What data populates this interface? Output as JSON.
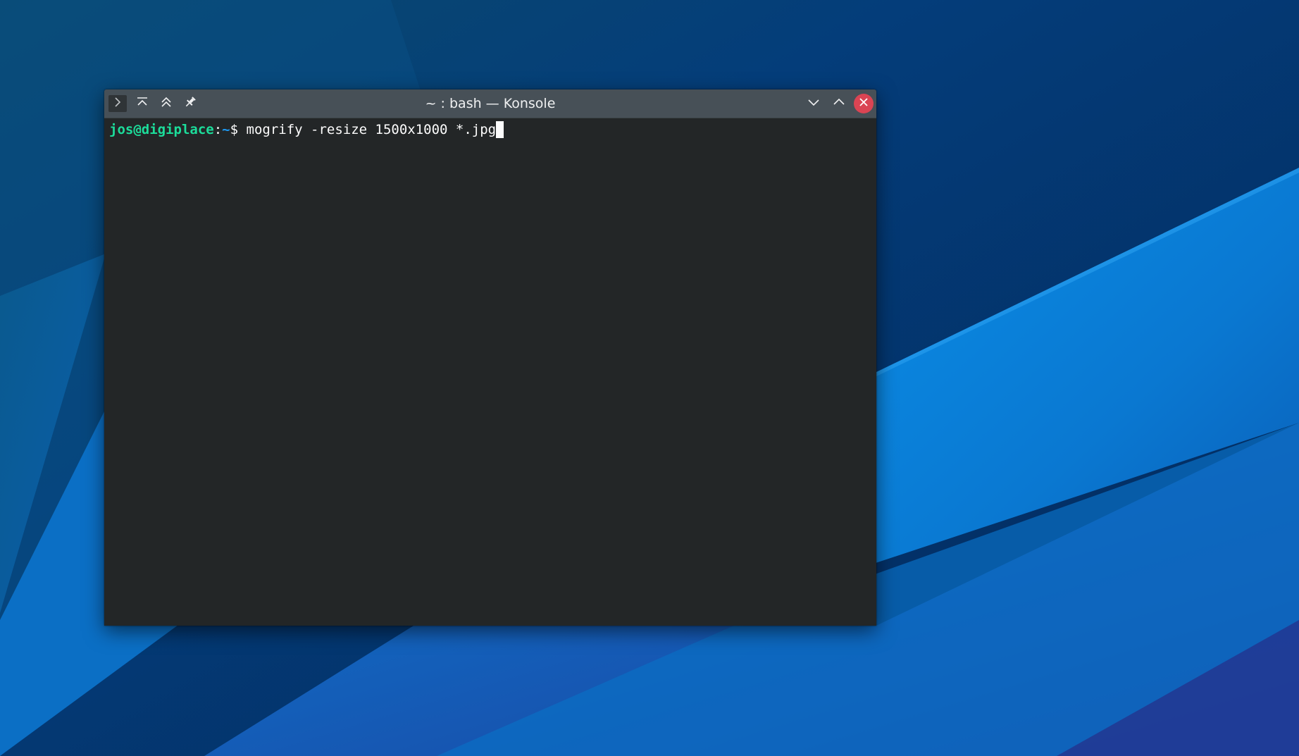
{
  "window": {
    "title": "~ : bash — Konsole",
    "app": "Konsole"
  },
  "titlebar": {
    "left_buttons": [
      {
        "name": "app-menu",
        "icon": "terminal-icon"
      },
      {
        "name": "keep-above",
        "icon": "keep-above-icon"
      },
      {
        "name": "keep-above-others",
        "icon": "double-chevron-up-icon"
      },
      {
        "name": "pin-all-desktops",
        "icon": "pin-icon"
      }
    ],
    "right_buttons": [
      {
        "name": "minimize",
        "icon": "chevron-down-icon"
      },
      {
        "name": "maximize",
        "icon": "chevron-up-icon"
      },
      {
        "name": "close",
        "icon": "close-icon"
      }
    ]
  },
  "terminal": {
    "user_host": "jos@digiplace",
    "separator": ":",
    "path": "~",
    "prompt_symbol": "$ ",
    "command": "mogrify -resize 1500x1000 *.jpg"
  },
  "colors": {
    "titlebar": "#475057",
    "terminal_bg": "#232627",
    "prompt_user": "#1cdc9a",
    "prompt_path": "#1d99f3",
    "close_button": "#da4453",
    "desktop_bg": "#03386e"
  }
}
